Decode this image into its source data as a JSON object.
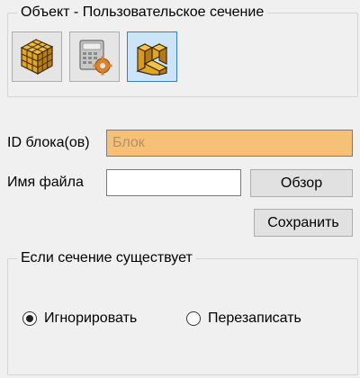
{
  "object_group": {
    "title": "Объект - Пользовательское сечение",
    "buttons": [
      {
        "icon": "cube-icon",
        "selected": false
      },
      {
        "icon": "calculator-gear-icon",
        "selected": false
      },
      {
        "icon": "custom-section-icon",
        "selected": true
      }
    ]
  },
  "block_id": {
    "label": "ID блока(ов)",
    "placeholder": "Блок",
    "value": ""
  },
  "file_name": {
    "label": "Имя файла",
    "value": ""
  },
  "browse_label": "Обзор",
  "save_label": "Сохранить",
  "exists_group": {
    "title": "Если сечение существует",
    "options": [
      {
        "label": "Игнорировать",
        "checked": true
      },
      {
        "label": "Перезаписать",
        "checked": false
      }
    ]
  },
  "colors": {
    "highlight_field": "#f7c078",
    "selected_button": "#cce4f7",
    "block_faces": "#e8a826"
  }
}
